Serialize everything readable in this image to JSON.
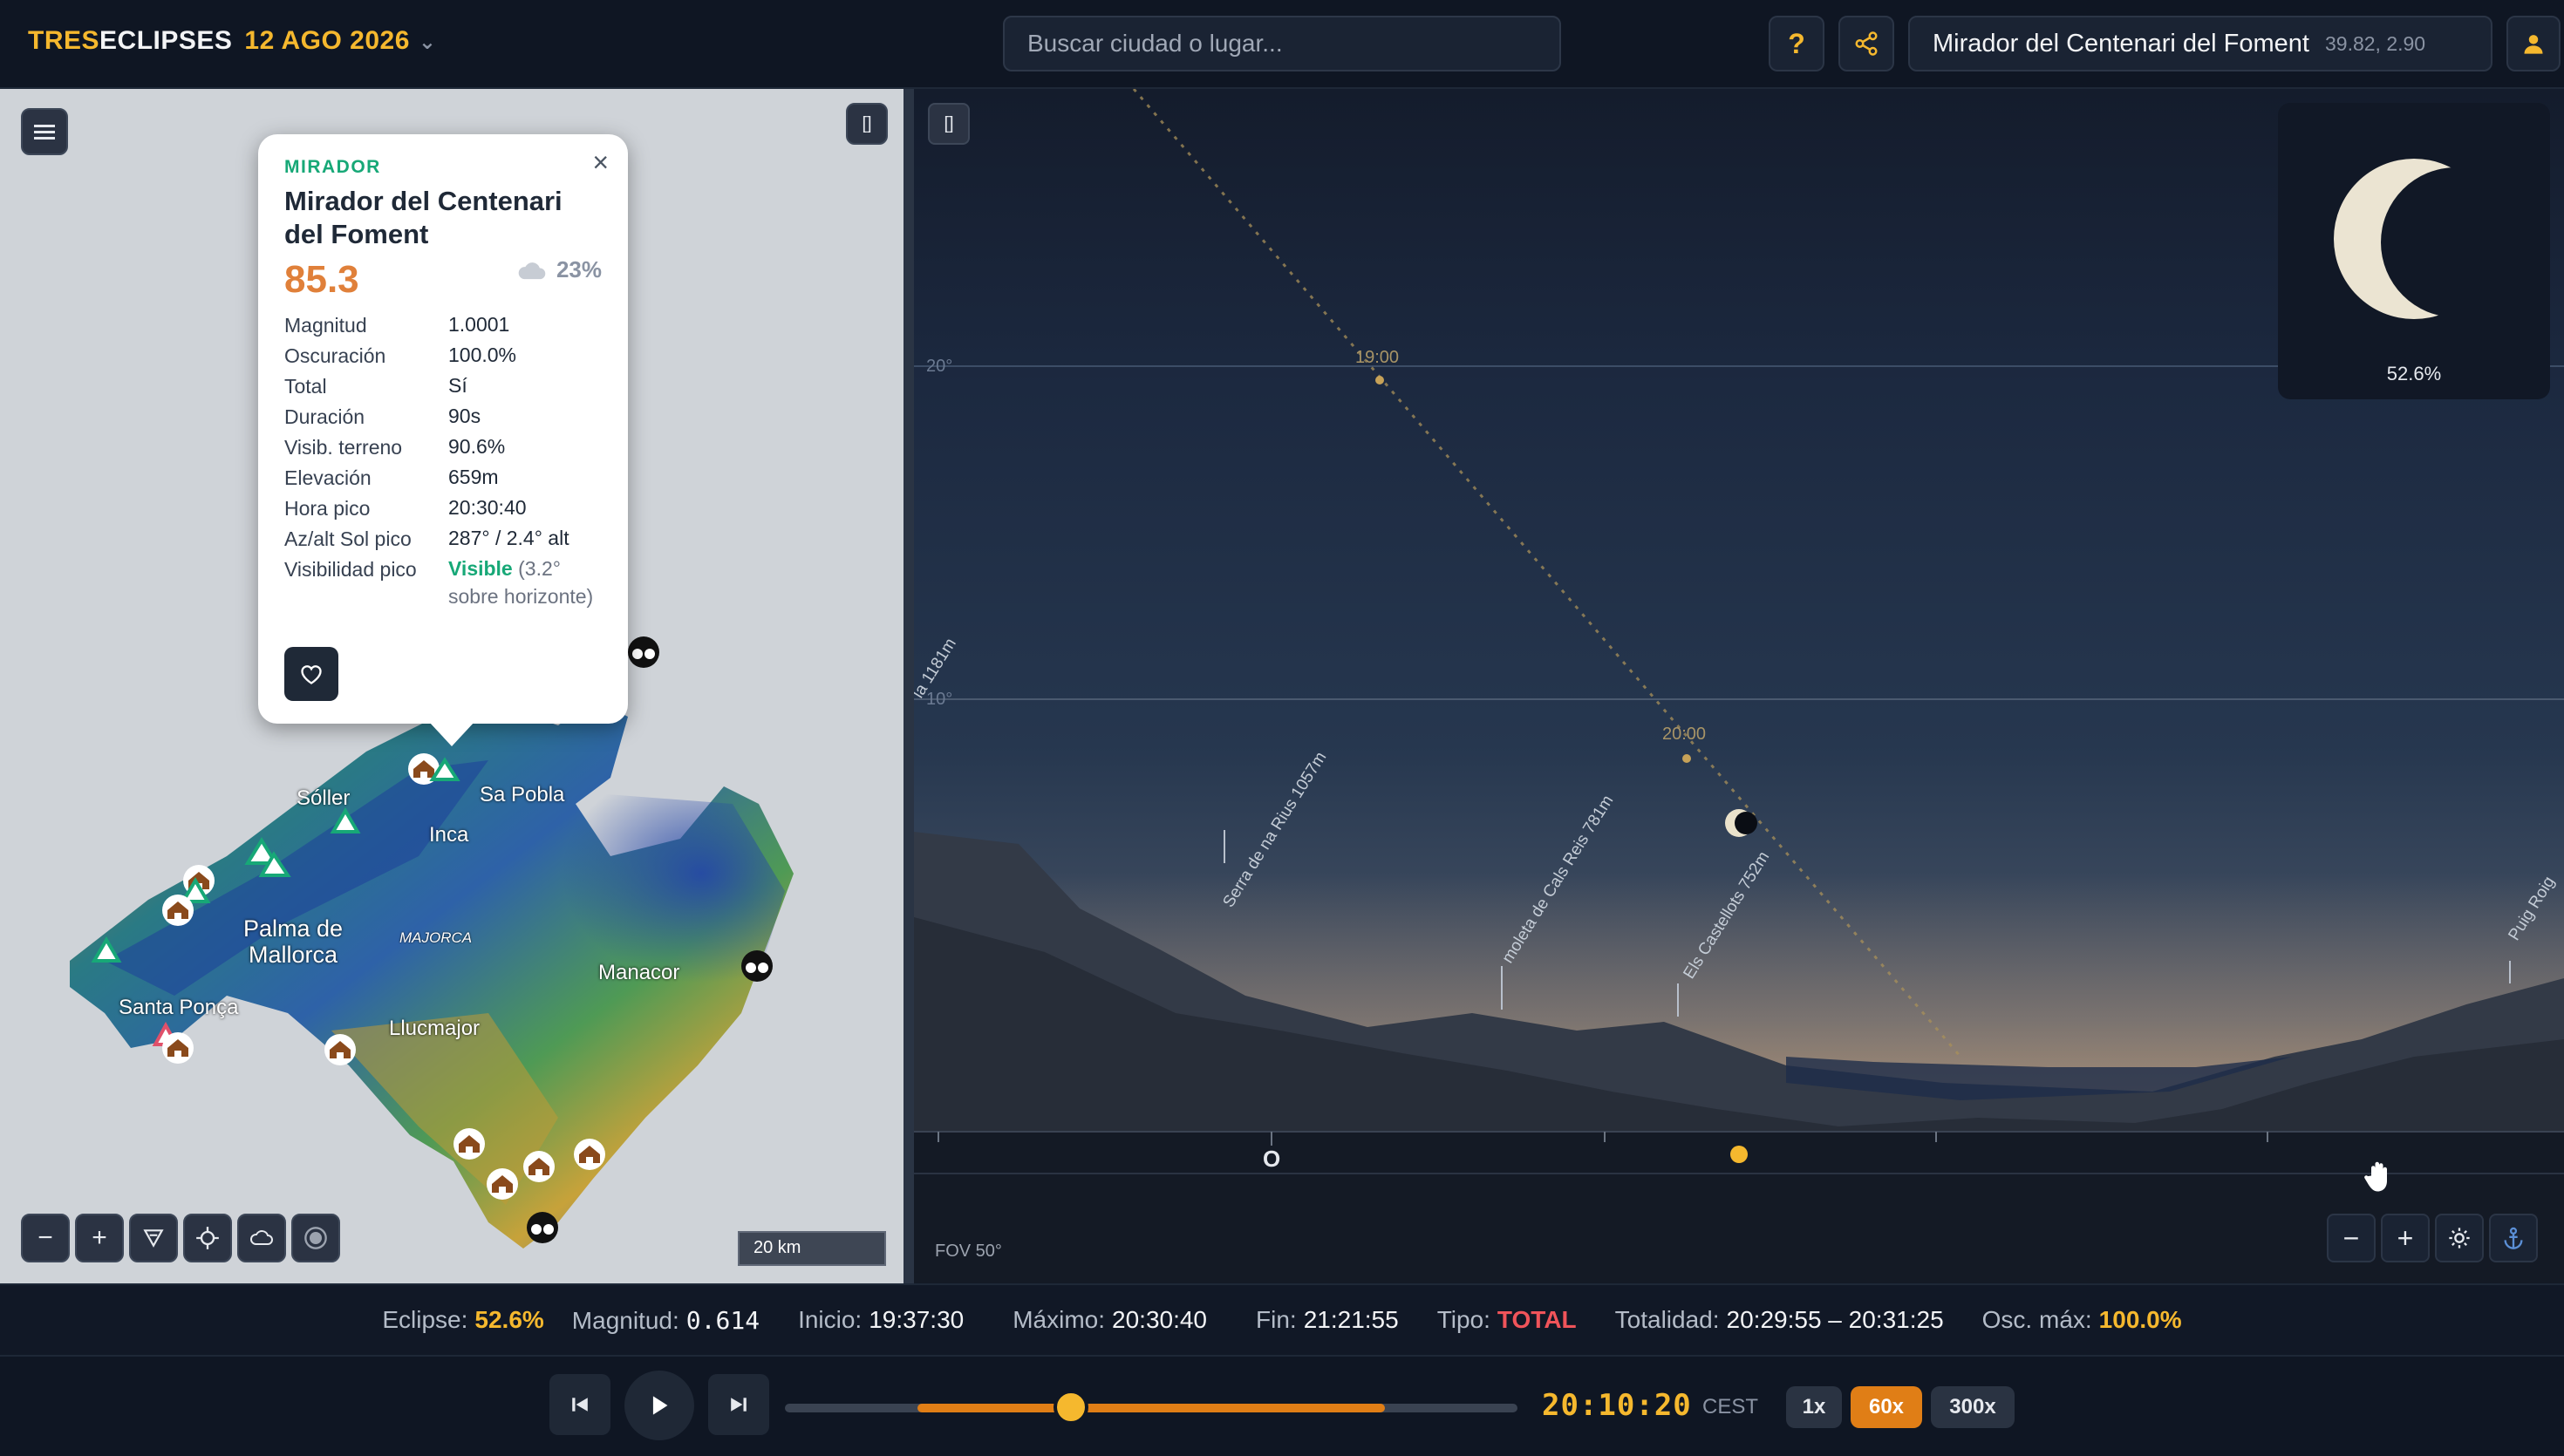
{
  "header": {
    "logo_part1": "TRES",
    "logo_part2": "ECLIPSES",
    "date": "12 AGO 2026",
    "search_placeholder": "Buscar ciudad o lugar...",
    "help_label": "?",
    "location_name": "Mirador del Centenari del Foment",
    "location_coords": "39.82, 2.90"
  },
  "map": {
    "expand_label": "[]",
    "scale_label": "20 km",
    "places": [
      "Sóller",
      "Sa Pobla",
      "Inca",
      "Palma de Mallorca",
      "MAJORCA",
      "Manacor",
      "Santa Ponça",
      "Llucmajor"
    ],
    "controls": [
      "−",
      "+"
    ]
  },
  "popup": {
    "type": "MIRADOR",
    "name": "Mirador del Centenari del Foment",
    "score": "85.3",
    "cloud": "23%",
    "rows": [
      {
        "k": "Magnitud",
        "v": "1.0001"
      },
      {
        "k": "Oscuración",
        "v": "100.0%"
      },
      {
        "k": "Total",
        "v": "Sí"
      },
      {
        "k": "Duración",
        "v": "90s"
      },
      {
        "k": "Visib. terreno",
        "v": "90.6%"
      },
      {
        "k": "Elevación",
        "v": "659m"
      },
      {
        "k": "Hora pico",
        "v": "20:30:40"
      },
      {
        "k": "Az/alt Sol pico",
        "v": "287° / 2.4° alt"
      }
    ],
    "visibility_label": "Visibilidad pico",
    "visibility_status": "Visible",
    "visibility_detail": "(3.2° sobre horizonte)"
  },
  "sky": {
    "expand_label": "[]",
    "alt_20": "20°",
    "alt_10": "10°",
    "time_1900": "19:00",
    "time_2000": "20:00",
    "peak_1": "Serra de na Rius 1057m",
    "peak_2": "moleta de Cals Reis 781m",
    "peak_3": "Els Castellots 752m",
    "peak_4": "Puig Roig",
    "peak_left": "la 1181m",
    "compass_w": "O",
    "moon_pct": "52.6%",
    "fov": "FOV 50°",
    "controls": [
      "−",
      "+"
    ]
  },
  "info": {
    "eclipse_label": "Eclipse:",
    "eclipse_value": "52.6%",
    "magnitud_label": "Magnitud:",
    "magnitud_value": "0.614",
    "inicio_label": "Inicio:",
    "inicio_value": "19:37:30",
    "maximo_label": "Máximo:",
    "maximo_value": "20:30:40",
    "fin_label": "Fin:",
    "fin_value": "21:21:55",
    "tipo_label": "Tipo:",
    "tipo_value": "TOTAL",
    "totalidad_label": "Totalidad:",
    "totalidad_value": "20:29:55 – 20:31:25",
    "osc_label": "Osc. máx:",
    "osc_value": "100.0%"
  },
  "playback": {
    "time": "20:10:20",
    "timezone": "CEST",
    "progress": 0.39,
    "speeds": [
      "1x",
      "60x",
      "300x"
    ],
    "active_speed": "60x"
  },
  "colors": {
    "accent": "#f5b82e",
    "orange": "#e07e16",
    "total_red": "#f0545a",
    "green": "#17a877"
  }
}
